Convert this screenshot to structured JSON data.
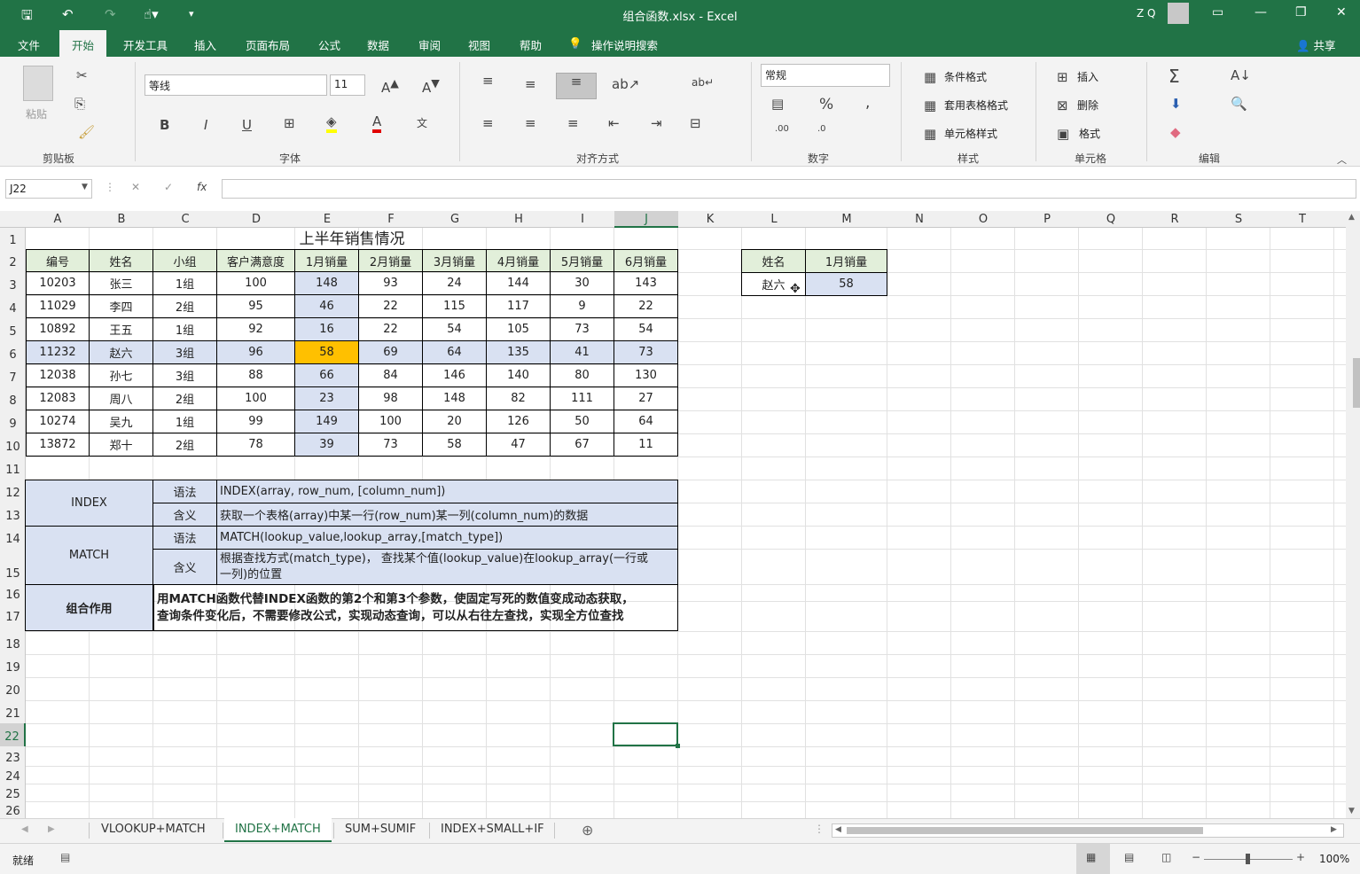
{
  "app": {
    "title": "组合函数.xlsx  -  Excel",
    "user": "Z Q",
    "quick_access": [
      "save-icon",
      "undo-icon",
      "redo-icon",
      "touch-mode-icon",
      "customize-icon"
    ]
  },
  "ribbon_tabs": [
    "文件",
    "开始",
    "开发工具",
    "插入",
    "页面布局",
    "公式",
    "数据",
    "审阅",
    "视图",
    "帮助"
  ],
  "active_tab": "开始",
  "tell_me": "操作说明搜索",
  "share": "共享",
  "ribbon": {
    "clipboard": {
      "paste": "粘贴",
      "label": "剪贴板"
    },
    "font": {
      "name": "等线",
      "size": "11",
      "label": "字体",
      "bold": "B",
      "italic": "I",
      "underline": "U"
    },
    "alignment": {
      "label": "对齐方式"
    },
    "number": {
      "format": "常规",
      "label": "数字"
    },
    "styles": {
      "conditional": "条件格式",
      "table": "套用表格格式",
      "cell": "单元格样式",
      "label": "样式"
    },
    "cells": {
      "insert": "插入",
      "delete": "删除",
      "format": "格式",
      "label": "单元格"
    },
    "editing": {
      "label": "编辑"
    }
  },
  "formula_bar": {
    "name_box": "J22",
    "formula": ""
  },
  "columns": [
    "A",
    "B",
    "C",
    "D",
    "E",
    "F",
    "G",
    "H",
    "I",
    "J",
    "K",
    "L",
    "M",
    "N",
    "O",
    "P",
    "Q",
    "R",
    "S",
    "T"
  ],
  "rows": [
    "1",
    "2",
    "3",
    "4",
    "5",
    "6",
    "7",
    "8",
    "9",
    "10",
    "11",
    "12",
    "13",
    "14",
    "15",
    "16",
    "17",
    "18",
    "19",
    "20",
    "21",
    "22",
    "23",
    "24",
    "25",
    "26"
  ],
  "sheet": {
    "title": "上半年销售情况",
    "headers": [
      "编号",
      "姓名",
      "小组",
      "客户满意度",
      "1月销量",
      "2月销量",
      "3月销量",
      "4月销量",
      "5月销量",
      "6月销量"
    ],
    "data": [
      [
        "10203",
        "张三",
        "1组",
        "100",
        "148",
        "93",
        "24",
        "144",
        "30",
        "143"
      ],
      [
        "11029",
        "李四",
        "2组",
        "95",
        "46",
        "22",
        "115",
        "117",
        "9",
        "22"
      ],
      [
        "10892",
        "王五",
        "1组",
        "92",
        "16",
        "22",
        "54",
        "105",
        "73",
        "54"
      ],
      [
        "11232",
        "赵六",
        "3组",
        "96",
        "58",
        "69",
        "64",
        "135",
        "41",
        "73"
      ],
      [
        "12038",
        "孙七",
        "3组",
        "88",
        "66",
        "84",
        "146",
        "140",
        "80",
        "130"
      ],
      [
        "12083",
        "周八",
        "2组",
        "100",
        "23",
        "98",
        "148",
        "82",
        "111",
        "27"
      ],
      [
        "10274",
        "吴九",
        "1组",
        "99",
        "149",
        "100",
        "20",
        "126",
        "50",
        "64"
      ],
      [
        "13872",
        "郑十",
        "2组",
        "78",
        "39",
        "73",
        "58",
        "47",
        "67",
        "11"
      ]
    ],
    "lookup": {
      "h1": "姓名",
      "h2": "1月销量",
      "name": "赵六",
      "value": "58"
    },
    "notes": {
      "index_name": "INDEX",
      "match_name": "MATCH",
      "combo_name": "组合作用",
      "syntax": "语法",
      "meaning": "含义",
      "index_syntax": "INDEX(array, row_num, [column_num])",
      "index_meaning": "获取一个表格(array)中某一行(row_num)某一列(column_num)的数据",
      "match_syntax": "MATCH(lookup_value,lookup_array,[match_type])",
      "match_meaning_1": "根据查找方式(match_type)， 查找某个值(lookup_value)在lookup_array(一行或",
      "match_meaning_2": "一列)的位置",
      "combo_1": "用MATCH函数代替INDEX函数的第2个和第3个参数，使固定写死的数值变成动态获取，",
      "combo_2": "查询条件变化后，不需要修改公式，实现动态查询，可以从右往左查找，实现全方位查找"
    }
  },
  "sheet_tabs": [
    "VLOOKUP+MATCH",
    "INDEX+MATCH",
    "SUM+SUMIF",
    "INDEX+SMALL+IF"
  ],
  "active_sheet": "INDEX+MATCH",
  "status": {
    "ready": "就绪",
    "zoom": "100%"
  }
}
